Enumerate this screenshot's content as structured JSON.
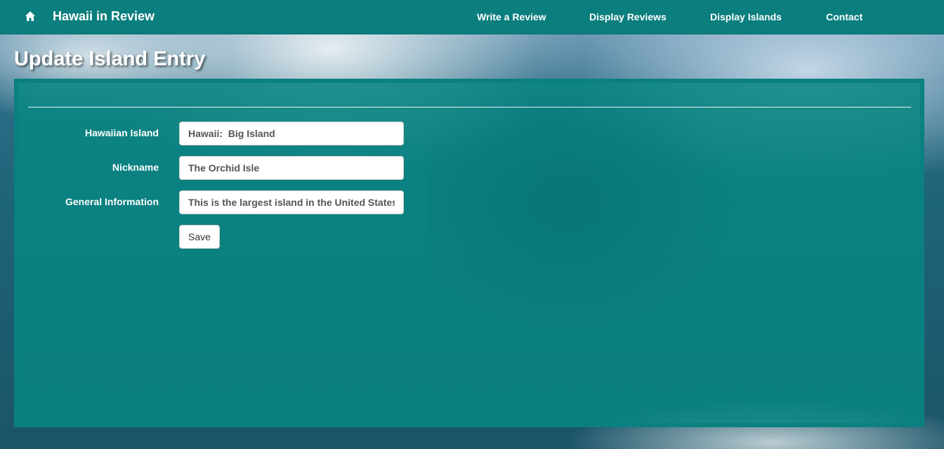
{
  "navbar": {
    "brand": "Hawaii in Review",
    "home_icon": "home-icon",
    "links": [
      "Write a Review",
      "Display Reviews",
      "Display Islands",
      "Contact"
    ]
  },
  "page": {
    "title": "Update Island Entry"
  },
  "form": {
    "fields": [
      {
        "label": "Hawaiian Island",
        "value": "Hawaii:  Big Island"
      },
      {
        "label": "Nickname",
        "value": "The Orchid Isle"
      },
      {
        "label": "General Information",
        "value": "This is the largest island in the United States"
      }
    ],
    "save_label": "Save"
  },
  "colors": {
    "navbar": "#0b7e7e",
    "panel": "#088682",
    "panel_border": "#0a8080"
  }
}
